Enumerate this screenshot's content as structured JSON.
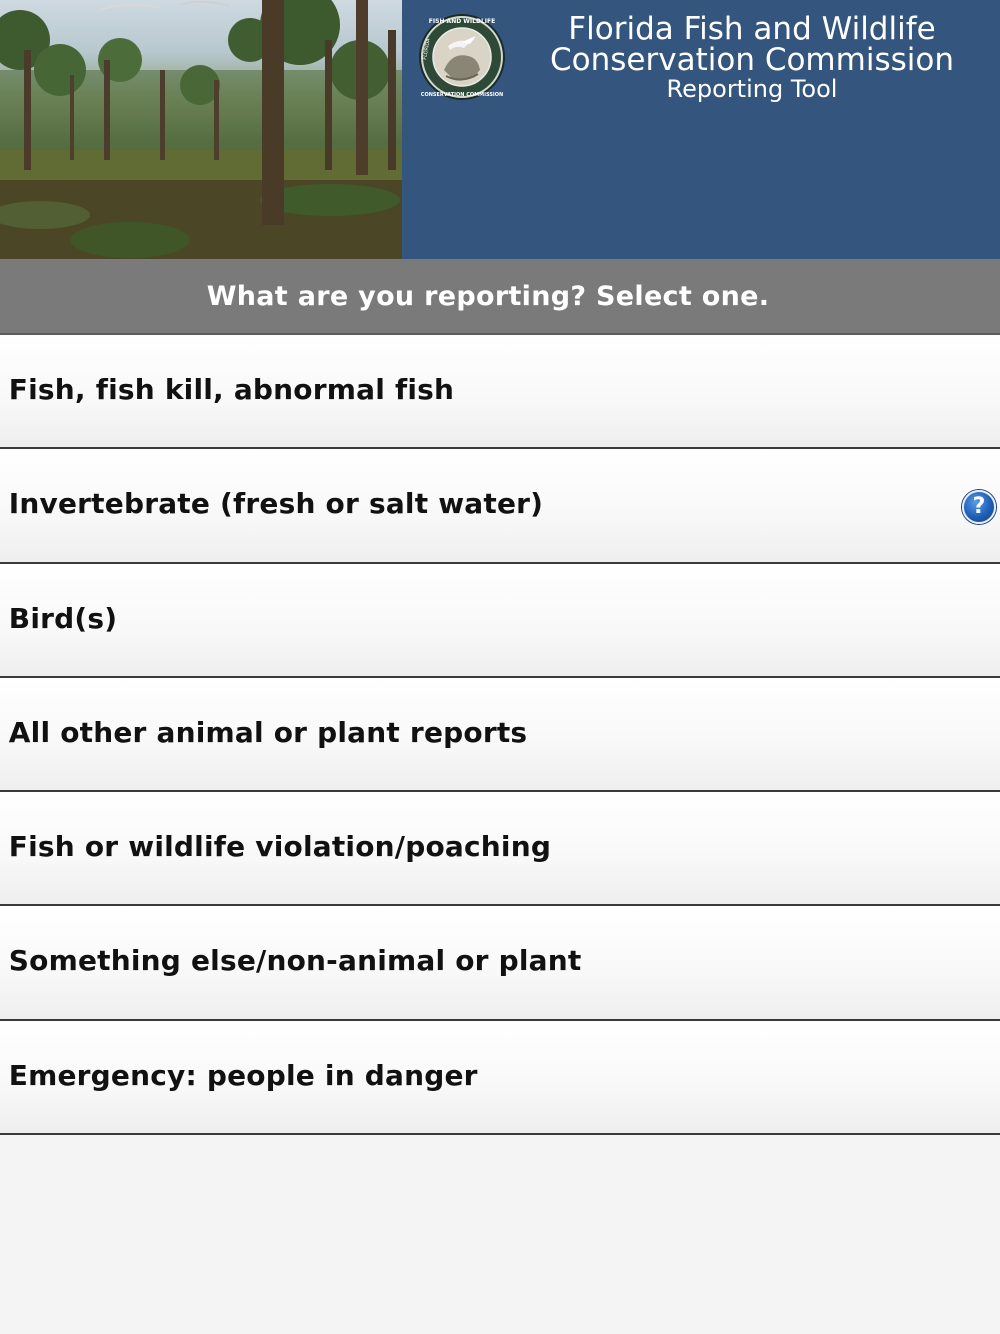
{
  "header": {
    "title_line1": "Florida Fish and Wildlife",
    "title_line2": "Conservation Commission",
    "subtitle": "Reporting Tool",
    "seal_text_top": "FISH AND WILDLIFE",
    "seal_text_left": "FLORIDA",
    "seal_text_bottom": "CONSERVATION COMMISSION"
  },
  "prompt": "What are you reporting? Select one.",
  "items": [
    {
      "label": ". Fish, fish kill, abnormal fish"
    },
    {
      "label": ". Invertebrate (fresh or salt water)"
    },
    {
      "label": ". Bird(s)"
    },
    {
      "label": ". All other animal or plant reports"
    },
    {
      "label": ". Fish or wildlife violation/poaching"
    },
    {
      "label": ". Something else/non-animal or plant"
    },
    {
      "label": ". Emergency: people in danger"
    }
  ],
  "help_icon": {
    "glyph": "?",
    "icon": "help-question-icon"
  },
  "colors": {
    "header_panel": "#34557d",
    "prompt_bar": "#7a7a7a",
    "list_background": "#f4f4f4",
    "help_icon": "#1f5fb8"
  }
}
